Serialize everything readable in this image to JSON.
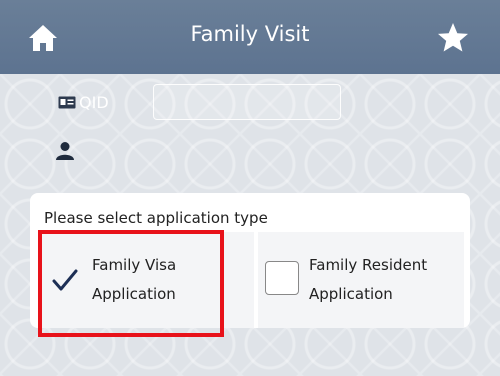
{
  "header": {
    "title": "Family Visit",
    "home_icon": "home-icon",
    "star_icon": "star-icon"
  },
  "form": {
    "qid_label": "QID",
    "qid_value": "",
    "qid_icon": "id-card-icon",
    "name_icon": "person-icon",
    "name_value": ""
  },
  "application_type": {
    "prompt": "Please select application type",
    "options": [
      {
        "line1": "Family Visa",
        "line2": "Application",
        "selected": true
      },
      {
        "line1": "Family Resident",
        "line2": "Application",
        "selected": false
      }
    ]
  },
  "colors": {
    "header": "#5d7390",
    "highlight": "#e8121a",
    "check": "#1d2f55"
  }
}
